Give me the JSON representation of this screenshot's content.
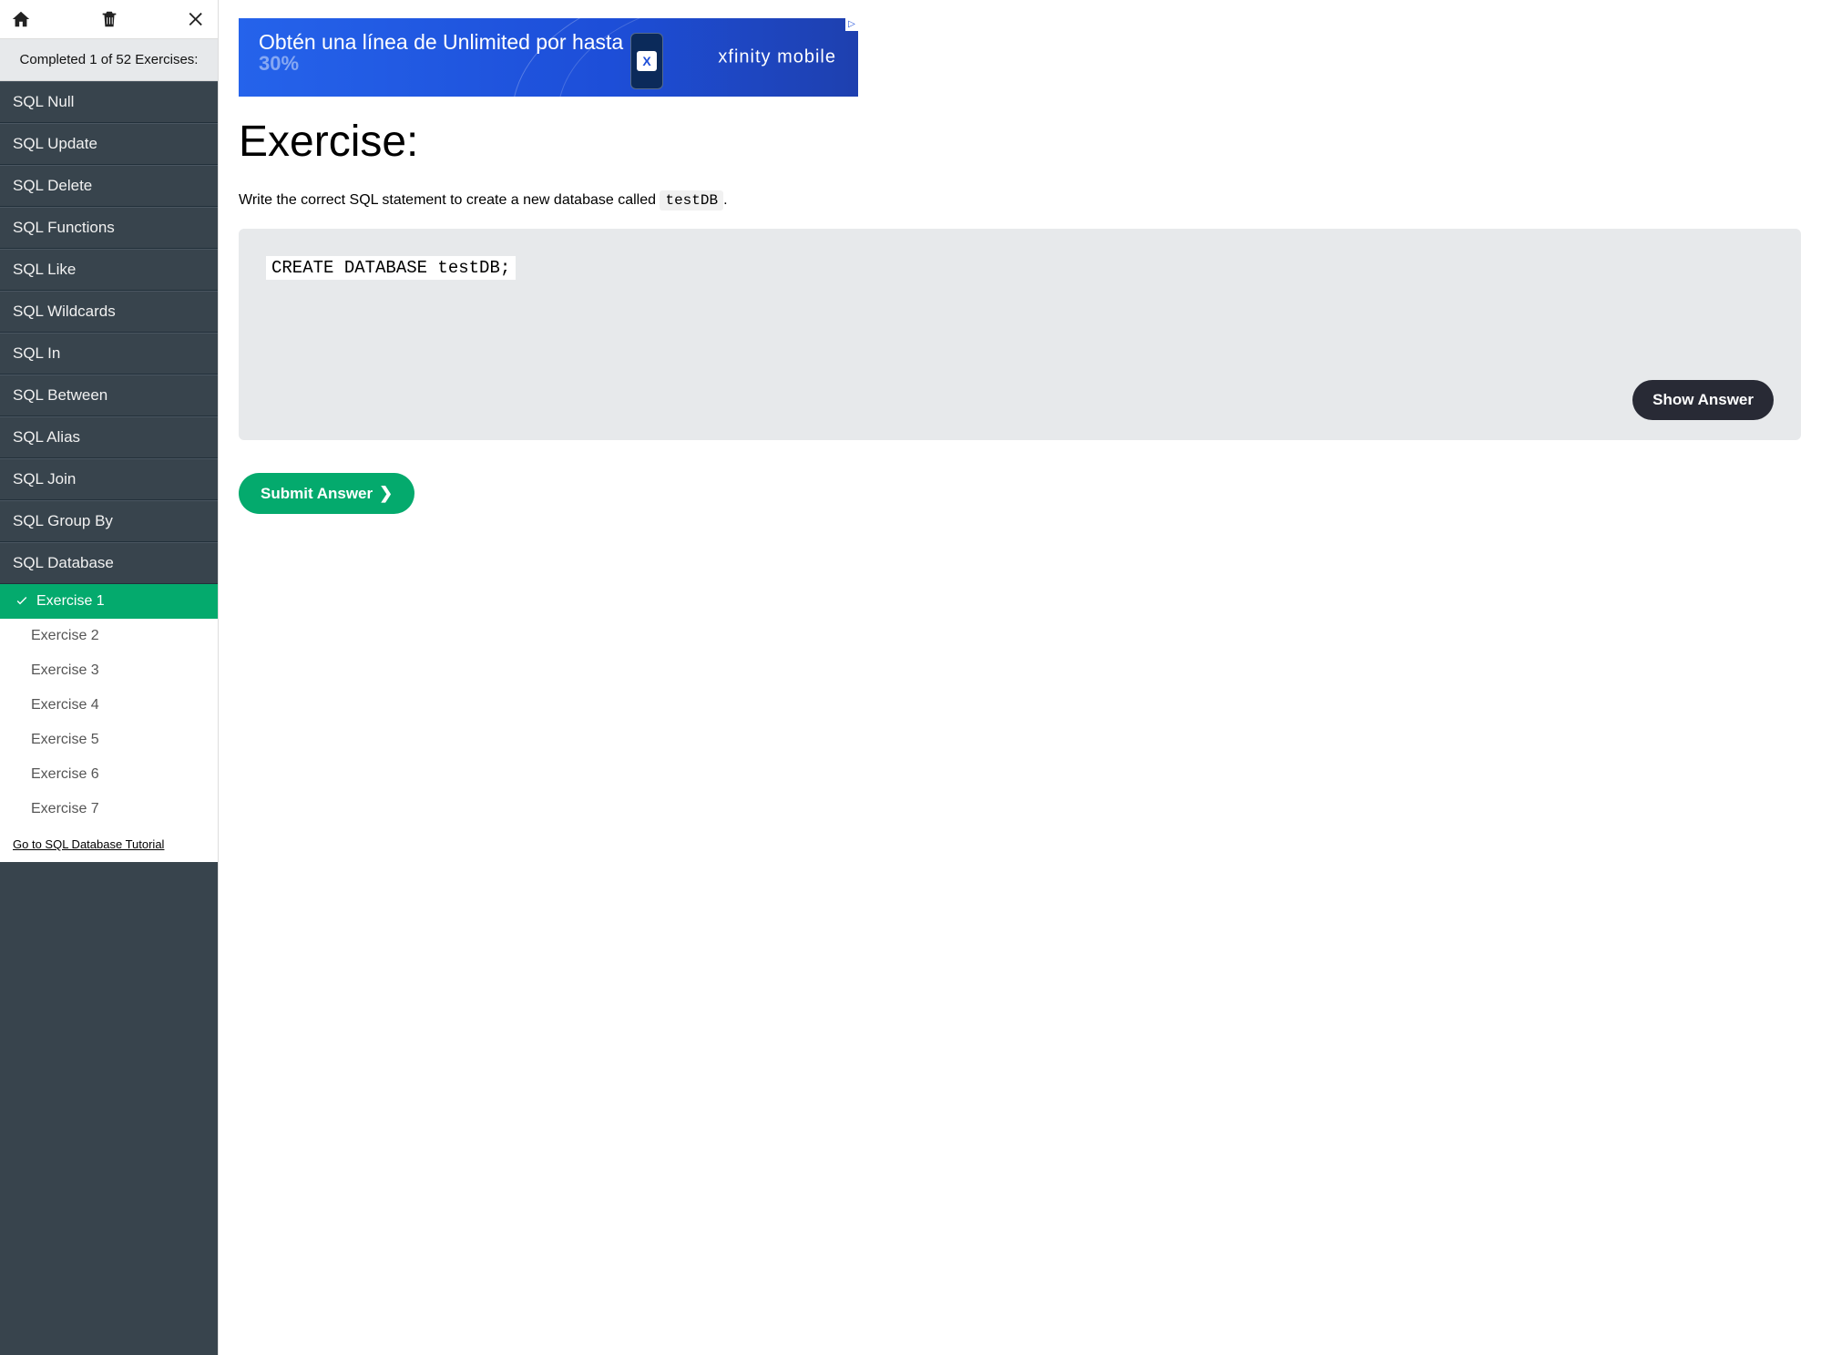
{
  "sidebar": {
    "progress_text": "Completed 1 of 52 Exercises:",
    "topics": [
      "SQL Null",
      "SQL Update",
      "SQL Delete",
      "SQL Functions",
      "SQL Like",
      "SQL Wildcards",
      "SQL In",
      "SQL Between",
      "SQL Alias",
      "SQL Join",
      "SQL Group By",
      "SQL Database"
    ],
    "exercises": [
      {
        "label": "Exercise 1",
        "active": true,
        "completed": true
      },
      {
        "label": "Exercise 2",
        "active": false,
        "completed": false
      },
      {
        "label": "Exercise 3",
        "active": false,
        "completed": false
      },
      {
        "label": "Exercise 4",
        "active": false,
        "completed": false
      },
      {
        "label": "Exercise 5",
        "active": false,
        "completed": false
      },
      {
        "label": "Exercise 6",
        "active": false,
        "completed": false
      },
      {
        "label": "Exercise 7",
        "active": false,
        "completed": false
      }
    ],
    "tutorial_link": "Go to SQL Database Tutorial"
  },
  "ad": {
    "line1_a": "Obtén una línea de Unlimited por ",
    "line1_b": "hasta",
    "line2": "30%",
    "brand": "xfinity mobile",
    "phone_letter": "X"
  },
  "main": {
    "heading": "Exercise:",
    "instruction_pre": "Write the correct SQL statement to create a new database called ",
    "instruction_code": "testDB",
    "instruction_post": ".",
    "code_value": "CREATE DATABASE testDB;",
    "show_answer_label": "Show Answer",
    "submit_label": "Submit Answer"
  }
}
